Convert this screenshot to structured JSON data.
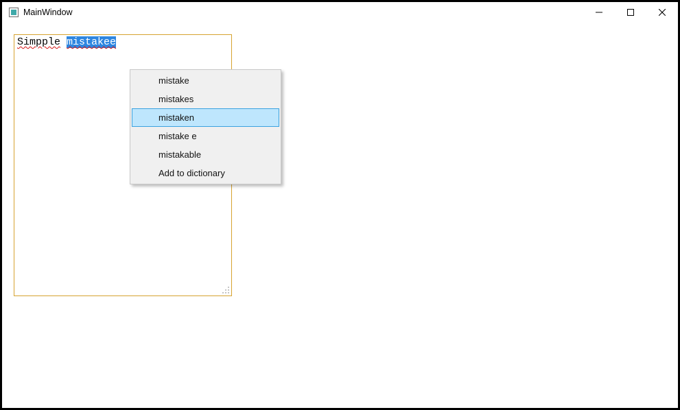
{
  "window": {
    "title": "MainWindow"
  },
  "editor": {
    "word1": "Simpple",
    "space": " ",
    "word2_selected": "mistakee"
  },
  "context_menu": {
    "items": [
      {
        "label": "mistake"
      },
      {
        "label": "mistakes"
      },
      {
        "label": "mistaken"
      },
      {
        "label": "mistake e"
      },
      {
        "label": "mistakable"
      },
      {
        "label": "Add to dictionary"
      }
    ],
    "hover_index": 2
  }
}
